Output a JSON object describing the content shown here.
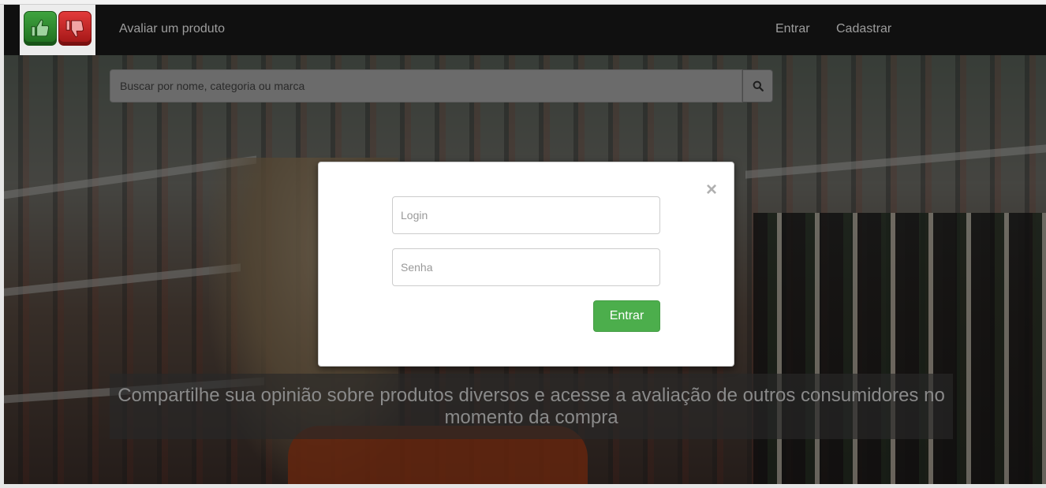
{
  "navbar": {
    "links": {
      "rate_product": "Avaliar um produto",
      "login": "Entrar",
      "signup": "Cadastrar"
    },
    "logo": {
      "icons": [
        "thumbs-up-icon",
        "thumbs-down-icon"
      ],
      "colors": {
        "up": "#2e8b2e",
        "down": "#c42020"
      }
    }
  },
  "search": {
    "placeholder": "Buscar por nome, categoria ou marca",
    "icon": "search-icon"
  },
  "hero": {
    "tagline": "Compartilhe sua opinião sobre produtos diversos e acesse a avaliação de outros consumidores no momento da compra"
  },
  "login_modal": {
    "close_symbol": "×",
    "login_placeholder": "Login",
    "password_placeholder": "Senha",
    "submit_label": "Entrar",
    "accent_color": "#4cae4c"
  }
}
